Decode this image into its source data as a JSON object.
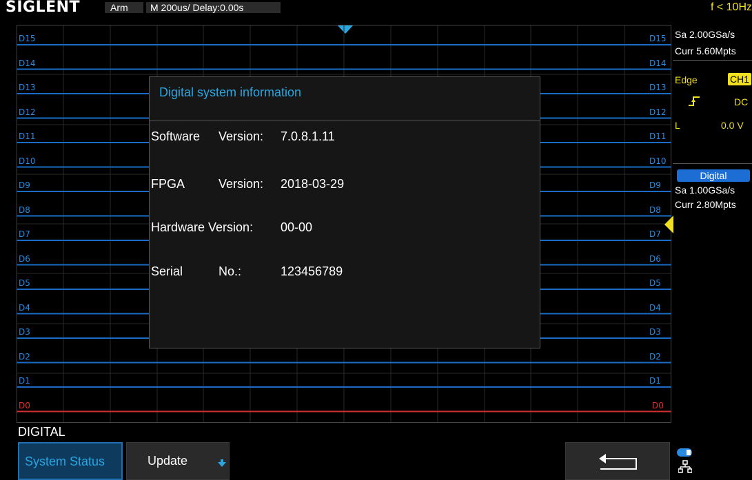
{
  "topbar": {
    "logo": "SIGLENT",
    "status": "Arm",
    "timebase": "M 200us/   Delay:0.00s",
    "frequency": "f < 10Hz"
  },
  "channels": {
    "left_labels": [
      "D15",
      "D14",
      "D13",
      "D12",
      "D11",
      "D10",
      "D9",
      "D8",
      "D7",
      "D6",
      "D5",
      "D4",
      "D3",
      "D2",
      "D1",
      "D0"
    ],
    "right_labels": [
      "D15",
      "D14",
      "D13",
      "D12",
      "D11",
      "D10",
      "D9",
      "D8",
      "D7",
      "D6",
      "D5",
      "D4",
      "D3",
      "D2",
      "D1",
      "D0"
    ],
    "trace_color": "#1a6cc4",
    "d0_color": "#d03030"
  },
  "right_panel": {
    "sample_rate": "Sa 2.00GSa/s",
    "curr_points": "Curr 5.60Mpts",
    "trigger_type": "Edge",
    "trigger_source": "CH1",
    "coupling": "DC",
    "level_label": "L",
    "level_value": "0.0 V",
    "digital_label": "Digital",
    "digital_sample_rate": "Sa 1.00GSa/s",
    "digital_curr_points": "Curr 2.80Mpts"
  },
  "dialog": {
    "title": "Digital system information",
    "rows": [
      {
        "label": "Software",
        "key": "Version:",
        "value": "7.0.8.1.11"
      },
      {
        "label": "FPGA",
        "key": "Version:",
        "value": "2018-03-29"
      },
      {
        "label": "Hardware Version:",
        "key": "",
        "value": "00-00"
      },
      {
        "label": "Serial",
        "key": "No.:",
        "value": "123456789"
      }
    ]
  },
  "menu": {
    "title": "DIGITAL",
    "system_status_label": "System Status",
    "update_label": "Update"
  },
  "icons": {
    "trigger_edge": "rising-edge-icon",
    "back": "return-arrow-icon",
    "network": "network-icon",
    "toggle": "toggle-icon"
  }
}
